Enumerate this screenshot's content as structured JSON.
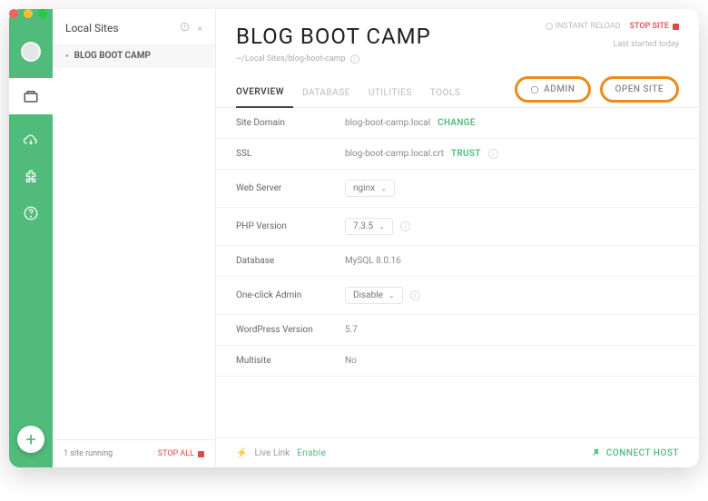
{
  "sidebar": {
    "title": "Local Sites",
    "items": [
      {
        "label": "BLOG BOOT CAMP"
      }
    ]
  },
  "sidebar_footer": {
    "running": "1 site running",
    "stop_all": "STOP ALL"
  },
  "header": {
    "title": "BLOG BOOT CAMP",
    "path": "~/Local Sites/blog-boot-camp",
    "instant_reload": "INSTANT RELOAD",
    "stop_site": "STOP SITE",
    "last_started": "Last started today"
  },
  "tabs": {
    "overview": "OVERVIEW",
    "database": "DATABASE",
    "utilities": "UTILITIES",
    "tools": "TOOLS"
  },
  "actions": {
    "admin": "ADMIN",
    "open_site": "OPEN SITE"
  },
  "details": {
    "site_domain_label": "Site Domain",
    "site_domain_value": "blog-boot-camp.local",
    "change": "CHANGE",
    "ssl_label": "SSL",
    "ssl_value": "blog-boot-camp.local.crt",
    "trust": "TRUST",
    "web_server_label": "Web Server",
    "web_server_value": "nginx",
    "php_label": "PHP Version",
    "php_value": "7.3.5",
    "db_label": "Database",
    "db_value": "MySQL 8.0.16",
    "oca_label": "One-click Admin",
    "oca_value": "Disable",
    "wp_label": "WordPress Version",
    "wp_value": "5.7",
    "multisite_label": "Multisite",
    "multisite_value": "No"
  },
  "footer": {
    "live_link": "Live Link",
    "enable": "Enable",
    "connect": "CONNECT HOST"
  }
}
